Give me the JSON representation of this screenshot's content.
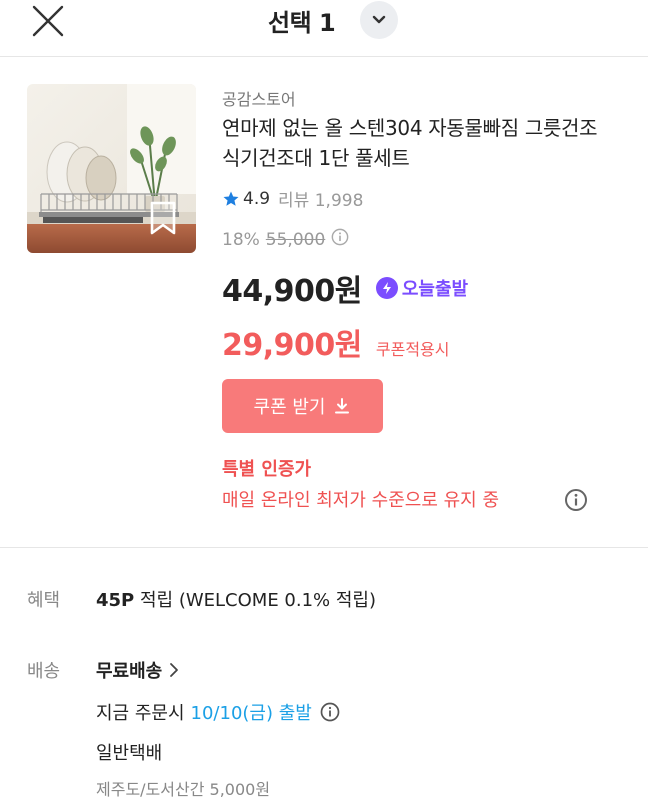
{
  "header": {
    "title": "선택 1"
  },
  "product": {
    "store": "공감스토어",
    "name": "연마제 없는 올 스텐304 자동물빠짐 그릇건조 식기건조대 1단 풀세트",
    "rating": "4.9",
    "review_label": "리뷰 1,998",
    "discount_rate": "18%",
    "original_price": "55,000",
    "price": "44,900원",
    "today_badge": "오늘출발",
    "coupon_price": "29,900원",
    "coupon_note": "쿠폰적용시",
    "coupon_button": "쿠폰 받기",
    "cert_title": "특별 인증가",
    "cert_desc": "매일 온라인 최저가 수준으로 유지 중"
  },
  "benefit": {
    "label": "혜택",
    "points": "45P",
    "detail": "적립 (WELCOME 0.1% 적립)"
  },
  "shipping": {
    "label": "배송",
    "free": "무료배송",
    "order_prefix": "지금 주문시",
    "order_date": "10/10(금) 출발",
    "type": "일반택배",
    "jeju": "제주도/도서산간 5,000원"
  },
  "colors": {
    "accent_red": "#f25c5c",
    "coupon_button": "#f87a7a",
    "today_purple": "#7b4dff",
    "date_blue": "#1ba0e6",
    "star_blue": "#1e7fe0"
  },
  "icons": [
    "close-icon",
    "chevron-down-icon",
    "bookmark-icon",
    "star-icon",
    "info-icon",
    "bolt-icon",
    "download-icon",
    "chevron-right-icon"
  ]
}
